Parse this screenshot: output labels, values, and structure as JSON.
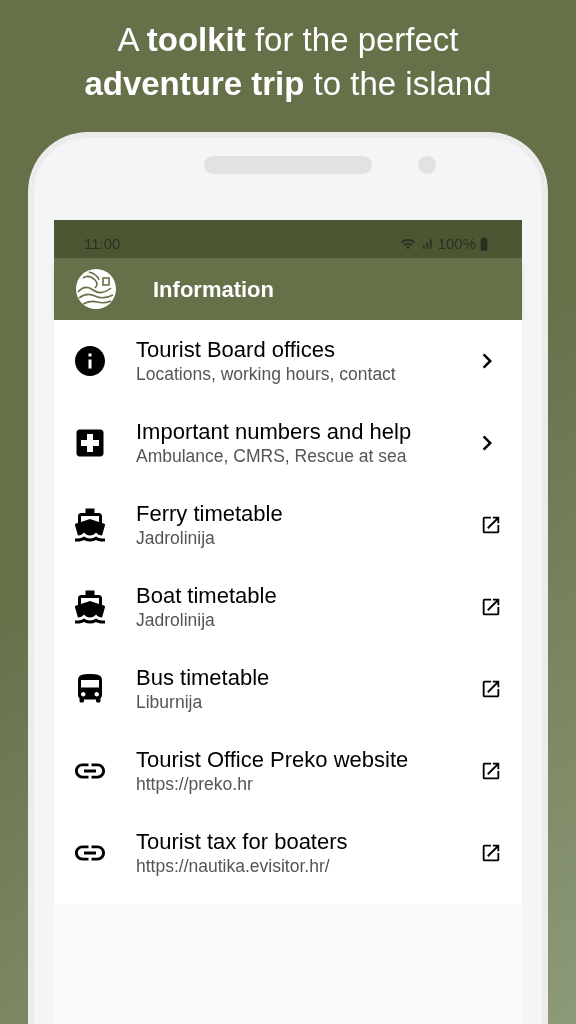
{
  "headline": [
    "A **toolkit** for the perfect",
    "**adventure trip** to the island"
  ],
  "status_bar": {
    "time": "11:00",
    "battery": "100%"
  },
  "app_bar": {
    "title": "Information"
  },
  "items": [
    {
      "title": "Tourist Board offices",
      "subtitle": "Locations, working hours, contact",
      "kind": "submenu"
    },
    {
      "title": "Important numbers and help",
      "subtitle": "Ambulance, CMRS, Rescue at sea",
      "kind": "submenu"
    },
    {
      "title": "Ferry timetable",
      "subtitle": "Jadrolinija",
      "kind": "external"
    },
    {
      "title": "Boat timetable",
      "subtitle": "Jadrolinija",
      "kind": "external"
    },
    {
      "title": "Bus timetable",
      "subtitle": "Liburnija",
      "kind": "external"
    },
    {
      "title": "Tourist Office Preko website",
      "subtitle": "https://preko.hr",
      "kind": "external"
    },
    {
      "title": "Tourist tax for boaters",
      "subtitle": "https://nautika.evisitor.hr/",
      "kind": "external"
    }
  ]
}
